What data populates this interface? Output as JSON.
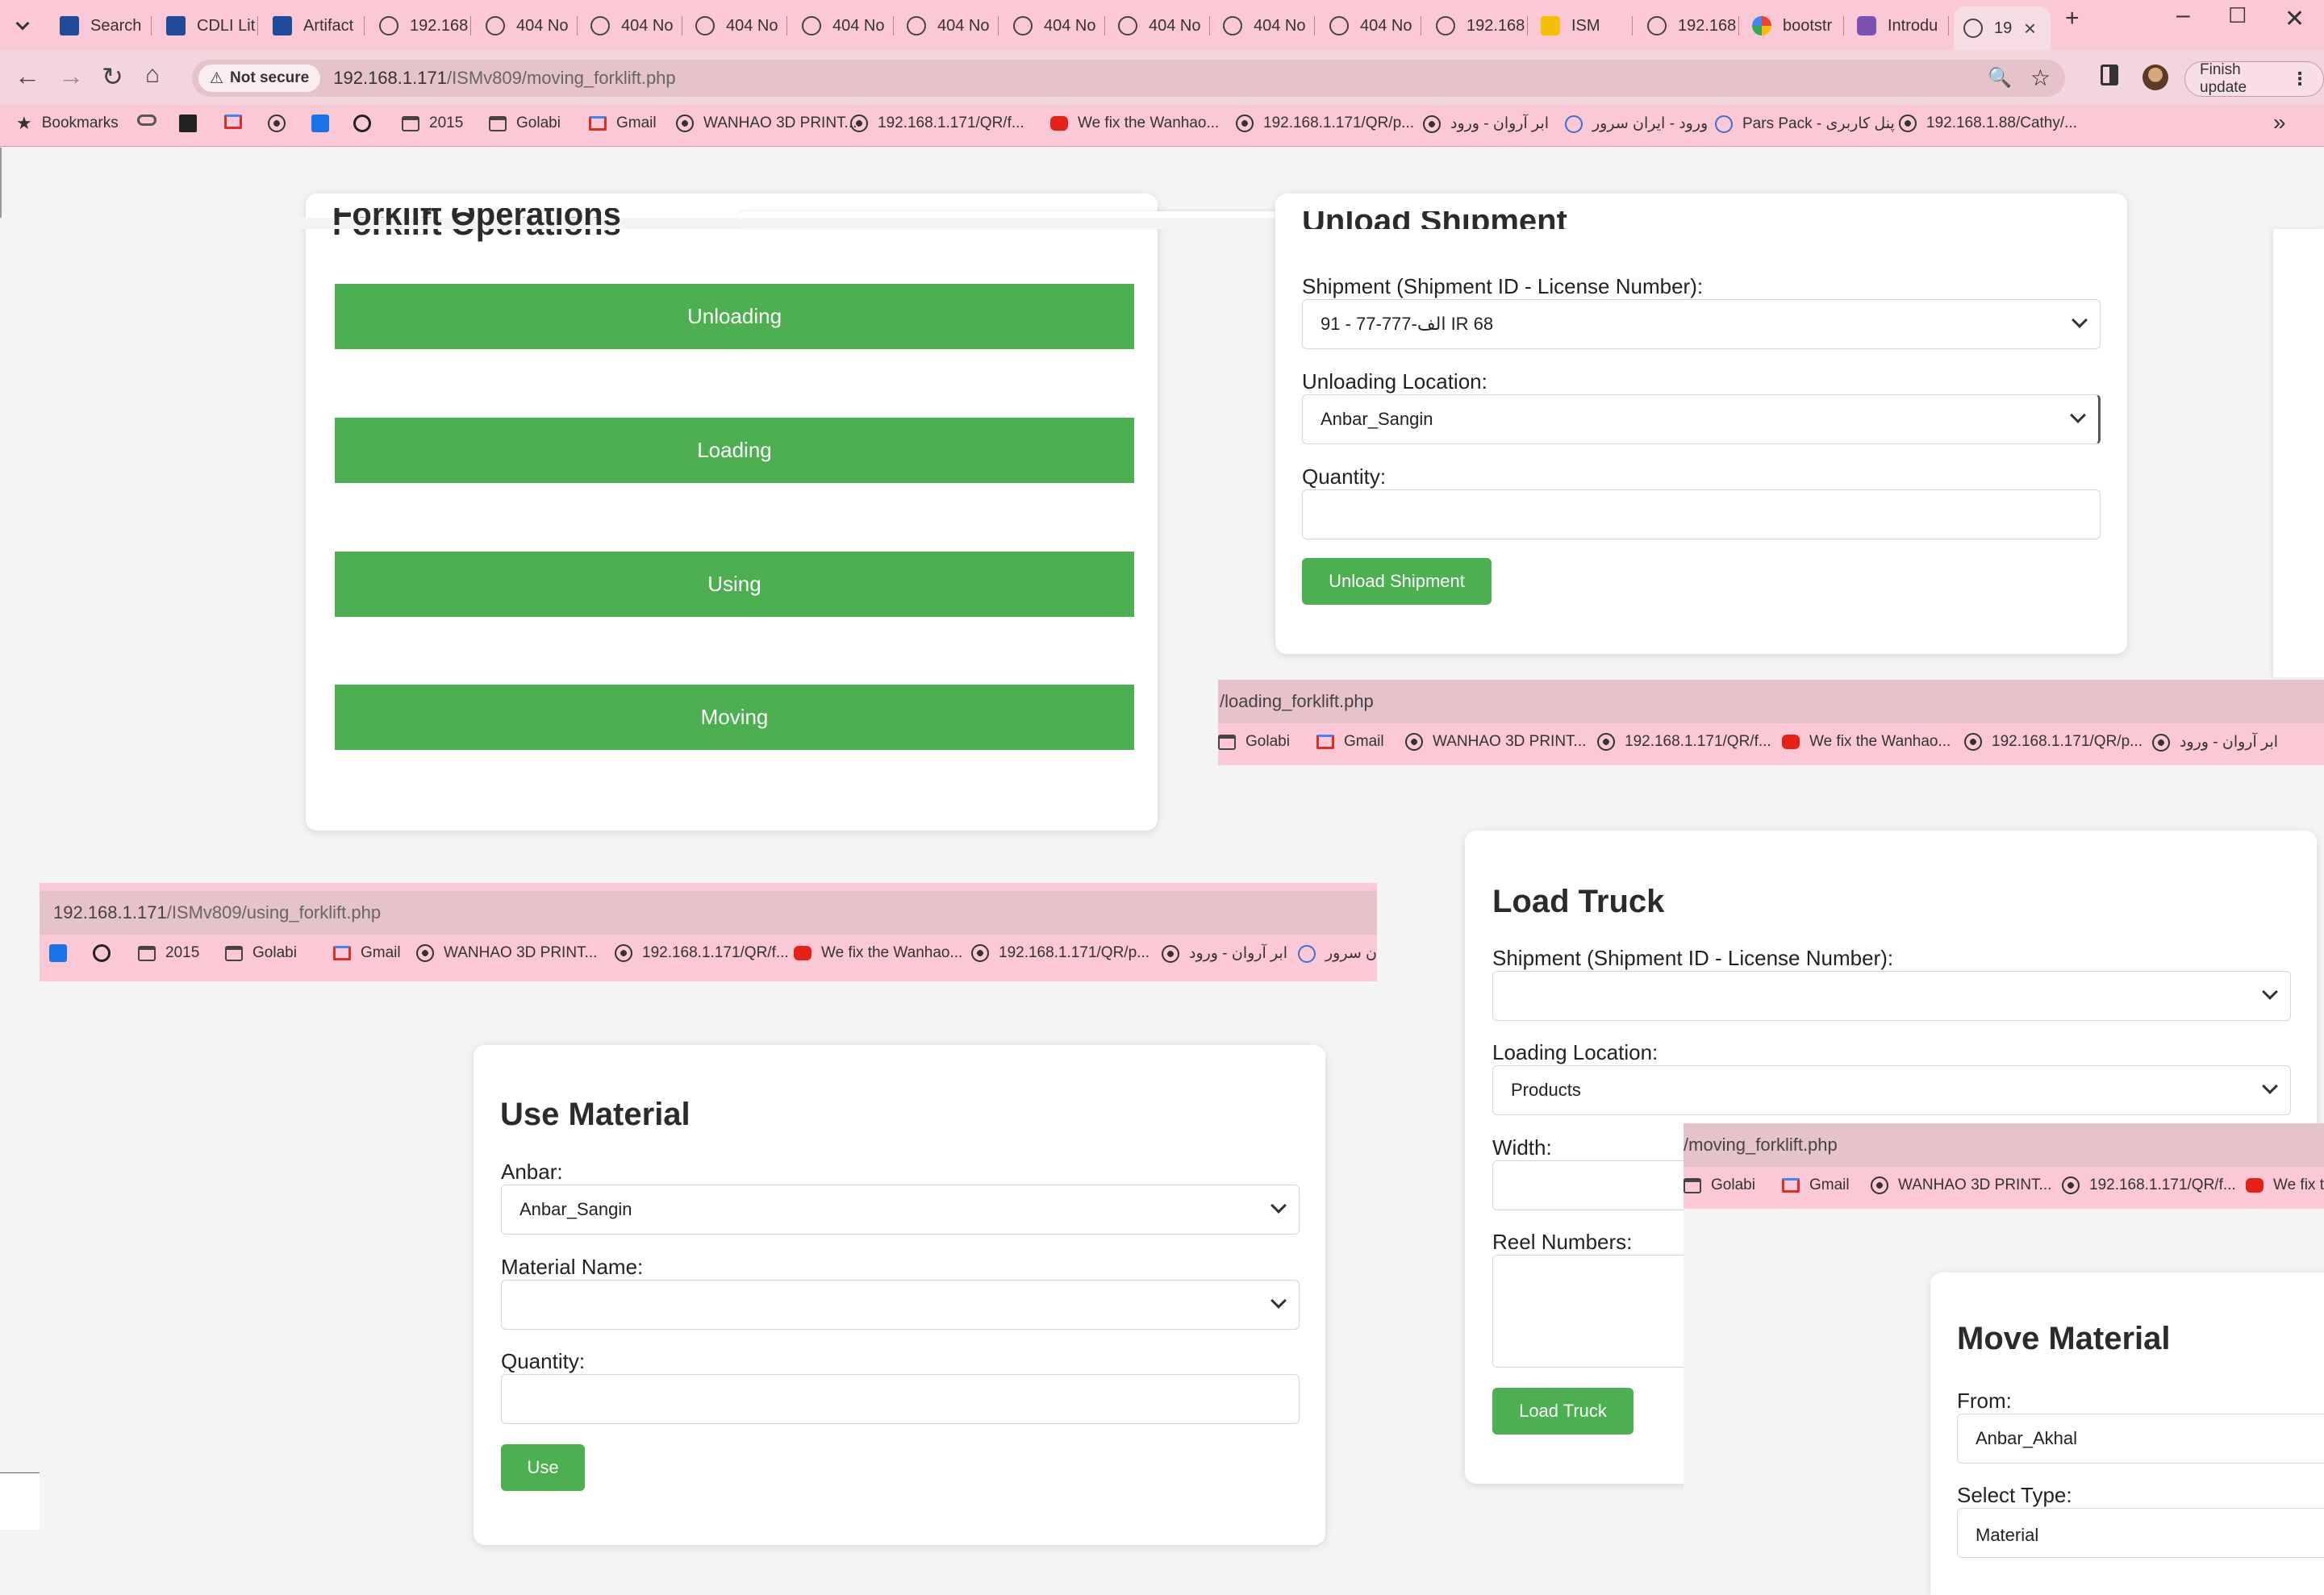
{
  "browser": {
    "tabs": [
      {
        "title": "Search",
        "icon": "cdli-icon"
      },
      {
        "title": "CDLI Lit",
        "icon": "cdli-icon"
      },
      {
        "title": "Artifact",
        "icon": "cdli-icon"
      },
      {
        "title": "192.168",
        "icon": "globe-icon"
      },
      {
        "title": "404 No",
        "icon": "globe-icon"
      },
      {
        "title": "404 No",
        "icon": "globe-icon"
      },
      {
        "title": "404 No",
        "icon": "globe-icon"
      },
      {
        "title": "404 No",
        "icon": "globe-icon"
      },
      {
        "title": "404 No",
        "icon": "globe-icon"
      },
      {
        "title": "404 No",
        "icon": "globe-icon"
      },
      {
        "title": "404 No",
        "icon": "globe-icon"
      },
      {
        "title": "404 No",
        "icon": "globe-icon"
      },
      {
        "title": "404 No",
        "icon": "globe-icon"
      },
      {
        "title": "192.168",
        "icon": "globe-icon"
      },
      {
        "title": "ISM",
        "icon": "ism-icon"
      },
      {
        "title": "192.168",
        "icon": "globe-icon"
      },
      {
        "title": "bootstr",
        "icon": "google-icon"
      },
      {
        "title": "Introdu",
        "icon": "bootstrap-icon"
      },
      {
        "title": "19",
        "icon": "globe-icon",
        "active": true
      }
    ],
    "new_tab_symbol": "+",
    "not_secure_label": "Not secure",
    "url_host": "192.168.1.171",
    "url_path": "/ISMv809/moving_forklift.php",
    "finish_update_label": "Finish update",
    "bookmarks": [
      {
        "label": "Bookmarks",
        "icon": "star-icon"
      },
      {
        "label": "",
        "icon": "link-icon"
      },
      {
        "label": "",
        "icon": "notion-icon"
      },
      {
        "label": "",
        "icon": "gmail-icon"
      },
      {
        "label": "",
        "icon": "globe-icon"
      },
      {
        "label": "",
        "icon": "calendar-icon"
      },
      {
        "label": "",
        "icon": "eye-icon"
      },
      {
        "label": "2015",
        "icon": "folder-icon"
      },
      {
        "label": "Golabi",
        "icon": "folder-icon"
      },
      {
        "label": "Gmail",
        "icon": "gmail-icon"
      },
      {
        "label": "WANHAO 3D PRINT...",
        "icon": "globe-icon"
      },
      {
        "label": "192.168.1.171/QR/f...",
        "icon": "globe-icon"
      },
      {
        "label": "We fix the Wanhao...",
        "icon": "youtube-icon"
      },
      {
        "label": "192.168.1.171/QR/p...",
        "icon": "globe-icon"
      },
      {
        "label": "ابر آروان - ورود",
        "icon": "globe-icon"
      },
      {
        "label": "ورود - ایران سرور",
        "icon": "iranserver-icon"
      },
      {
        "label": "Pars Pack - پنل کاربری",
        "icon": "parspack-icon"
      },
      {
        "label": "192.168.1.88/Cathy/...",
        "icon": "globe-icon"
      }
    ],
    "more_bookmarks_symbol": "»"
  },
  "forklift_ops": {
    "title": "Forklift Operations",
    "buttons": [
      "Unloading",
      "Loading",
      "Using",
      "Moving"
    ]
  },
  "unload": {
    "title": "Unload Shipment",
    "shipment_label": "Shipment (Shipment ID - License Number):",
    "shipment_value": "91 - 77-777-الف IR 68",
    "location_label": "Unloading Location:",
    "location_value": "Anbar_Sangin",
    "quantity_label": "Quantity:",
    "quantity_value": "",
    "submit_label": "Unload Shipment"
  },
  "frag_loading": {
    "url": "/loading_forklift.php",
    "bookmarks": [
      "Golabi",
      "Gmail",
      "WANHAO 3D PRINT...",
      "192.168.1.171/QR/f...",
      "We fix the Wanhao...",
      "192.168.1.171/QR/p...",
      "ابر آروان - ورود"
    ]
  },
  "frag_using": {
    "url_host": "192.168.1.171",
    "url_path": "/ISMv809/using_forklift.php",
    "bookmarks": [
      "",
      "",
      "2015",
      "Golabi",
      "Gmail",
      "WANHAO 3D PRINT...",
      "192.168.1.171/QR/f...",
      "We fix the Wanhao...",
      "192.168.1.171/QR/p...",
      "ابر آروان - ورود",
      "ران سرور"
    ]
  },
  "frag_moving": {
    "url": "/moving_forklift.php",
    "bookmarks": [
      "Golabi",
      "Gmail",
      "WANHAO 3D PRINT...",
      "192.168.1.171/QR/f...",
      "We fix th"
    ]
  },
  "load_truck": {
    "title": "Load Truck",
    "shipment_label": "Shipment (Shipment ID - License Number):",
    "shipment_value": "",
    "location_label": "Loading Location:",
    "location_value": "Products",
    "width_label": "Width:",
    "reel_label": "Reel Numbers:",
    "submit_label": "Load Truck"
  },
  "use_material": {
    "title": "Use Material",
    "anbar_label": "Anbar:",
    "anbar_value": "Anbar_Sangin",
    "material_label": "Material Name:",
    "material_value": "",
    "quantity_label": "Quantity:",
    "submit_label": "Use"
  },
  "move_material": {
    "title": "Move Material",
    "from_label": "From:",
    "from_value": "Anbar_Akhal",
    "type_label": "Select Type:",
    "type_value": "Material"
  },
  "colors": {
    "chrome_pink": "#fbc9d6",
    "accent_green": "#4caf50"
  }
}
